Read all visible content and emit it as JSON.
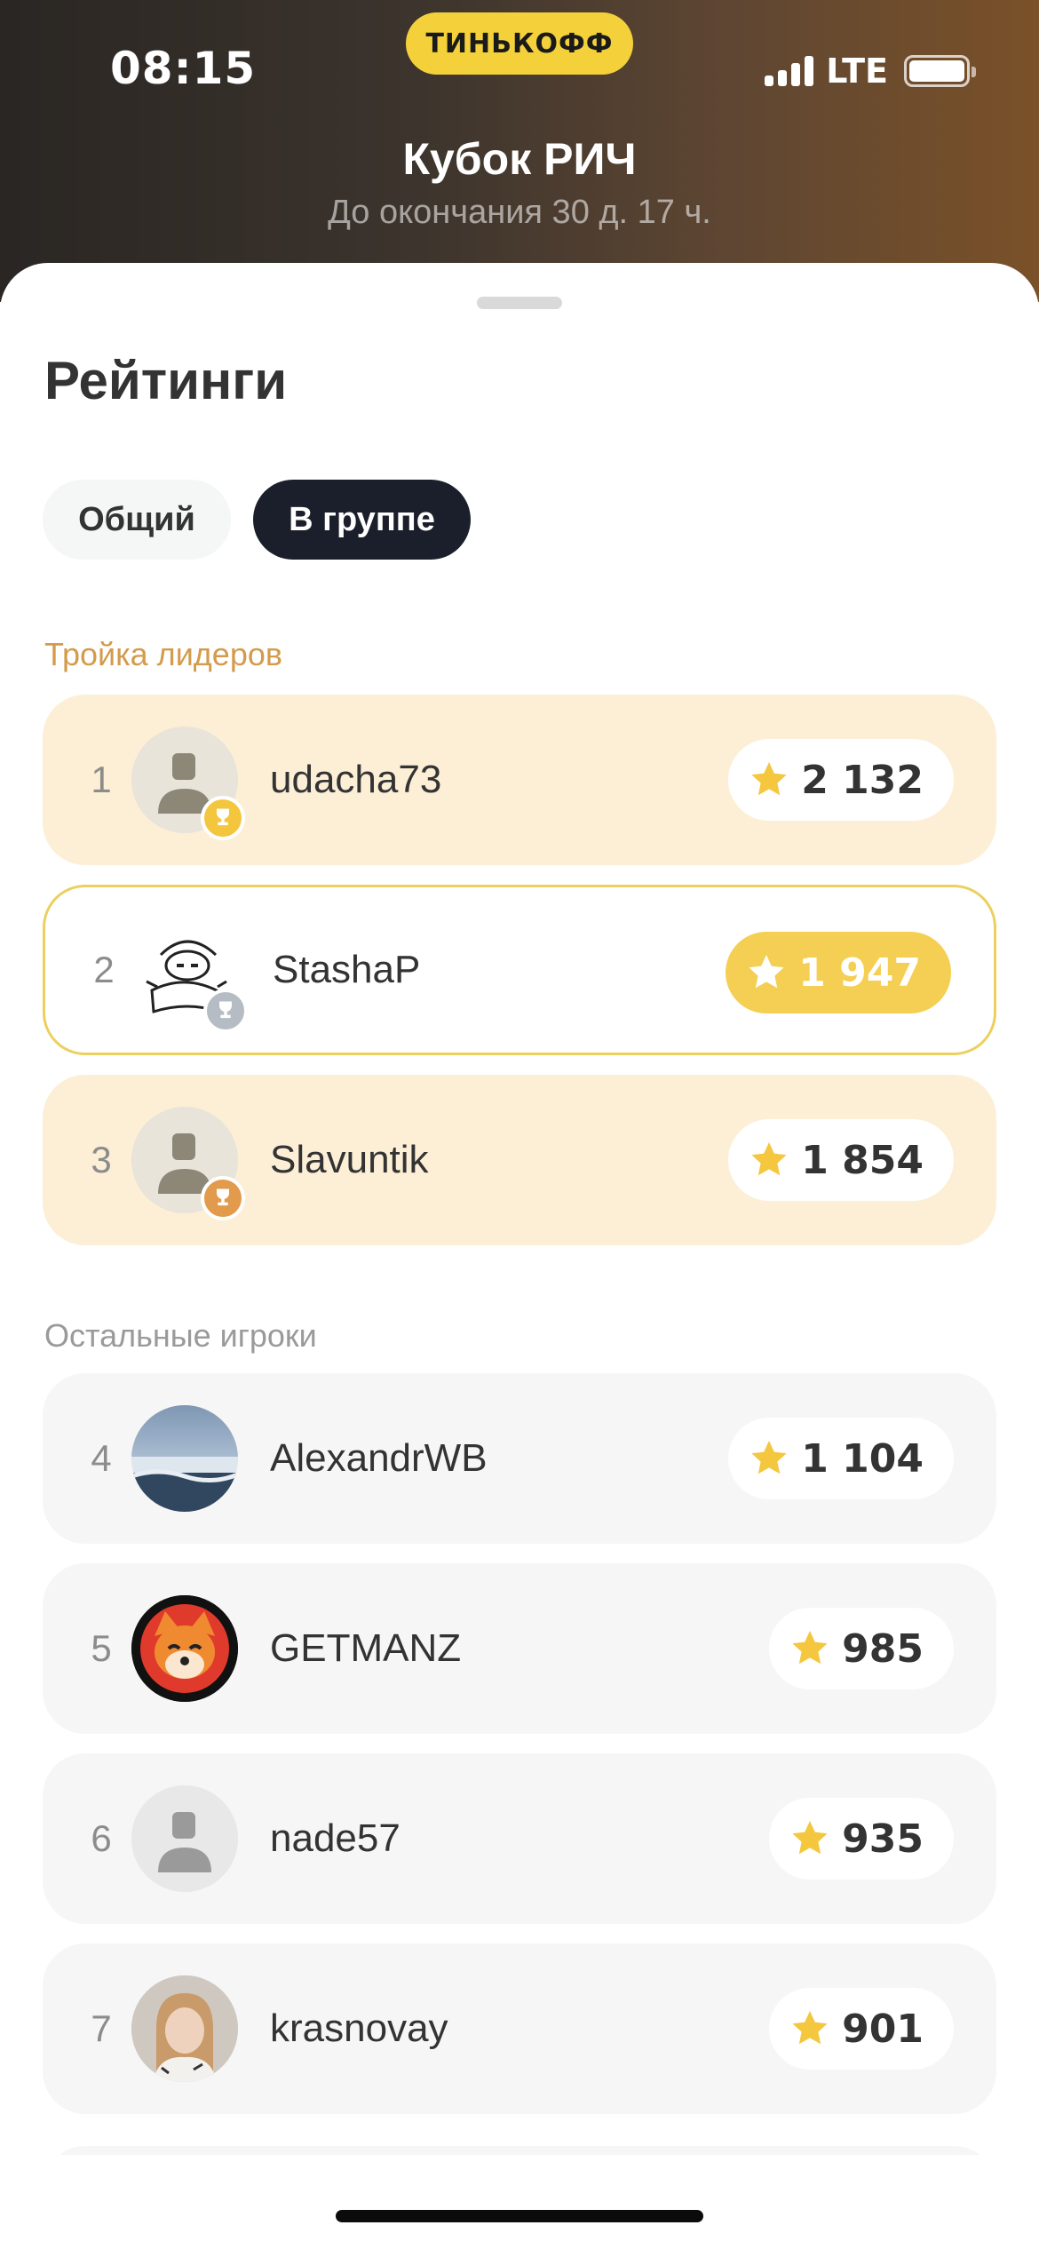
{
  "status_bar": {
    "time": "08:15",
    "brand": "ТИНЬКОФФ",
    "network": "LTE"
  },
  "header": {
    "title": "Кубок РИЧ",
    "subtitle": "До окончания 30 д. 17 ч."
  },
  "sheet": {
    "title": "Рейтинги",
    "tabs": [
      {
        "label": "Общий",
        "active": false
      },
      {
        "label": "В группе",
        "active": true
      }
    ],
    "leaders_label": "Тройка лидеров",
    "others_label": "Остальные игроки"
  },
  "leaders": [
    {
      "rank": "1",
      "name": "udacha73",
      "score": "2 132",
      "medal": "gold",
      "avatar": "placeholder-avatar-icon"
    },
    {
      "rank": "2",
      "name": "StashaP",
      "score": "1 947",
      "medal": "silver",
      "avatar": "sketch-avatar",
      "current_user": true
    },
    {
      "rank": "3",
      "name": "Slavuntik",
      "score": "1 854",
      "medal": "bronze",
      "avatar": "placeholder-avatar-icon"
    }
  ],
  "others": [
    {
      "rank": "4",
      "name": "AlexandrWB",
      "score": "1 104",
      "avatar": "sea-photo-avatar"
    },
    {
      "rank": "5",
      "name": "GETMANZ",
      "score": "985",
      "avatar": "shiba-avatar"
    },
    {
      "rank": "6",
      "name": "nade57",
      "score": "935",
      "avatar": "placeholder-avatar-icon"
    },
    {
      "rank": "7",
      "name": "krasnovay",
      "score": "901",
      "avatar": "photo-avatar"
    }
  ],
  "colors": {
    "brand_yellow": "#f4d13a",
    "leader_bg": "#fcefd6",
    "active_tab": "#1b1f2b",
    "star": "#f4c73f",
    "leaders_label": "#d39b4c"
  }
}
